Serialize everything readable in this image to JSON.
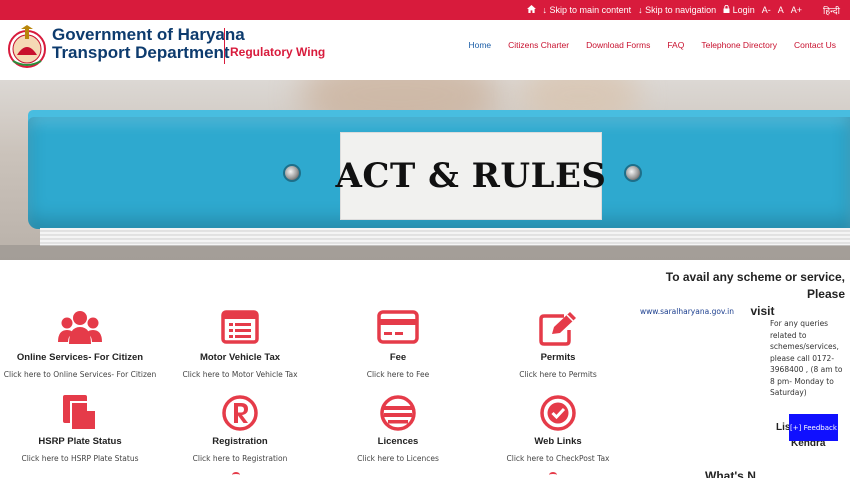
{
  "topbar": {
    "skip_main": "Skip to main content",
    "skip_nav": "Skip to navigation",
    "login": "Login",
    "font_small": "A-",
    "font_normal": "A",
    "font_large": "A+",
    "hindi": "हिन्दी"
  },
  "header": {
    "gov_title": "Government of Haryana",
    "dept_title": "Transport Department",
    "wing": "Regulatory Wing"
  },
  "nav": [
    "Home",
    "Citizens Charter",
    "Download Forms",
    "FAQ",
    "Telephone Directory",
    "Contact Us"
  ],
  "banner": {
    "label": "ACT & RULES"
  },
  "services": [
    {
      "title": "Online Services- For Citizen",
      "link": "Click here to Online Services- For Citizen",
      "icon": "users-icon"
    },
    {
      "title": "Motor Vehicle Tax",
      "link": "Click here to Motor Vehicle Tax",
      "icon": "list-window-icon"
    },
    {
      "title": "Fee",
      "link": "Click here to Fee",
      "icon": "credit-card-icon"
    },
    {
      "title": "Permits",
      "link": "Click here to Permits",
      "icon": "edit-icon"
    },
    {
      "title": "HSRP Plate Status",
      "link": "Click here to HSRP Plate Status",
      "icon": "file-copy-icon"
    },
    {
      "title": "Registration",
      "link": "Click here to Registration",
      "icon": "registered-icon"
    },
    {
      "title": "Licences",
      "link": "Click here to Licences",
      "icon": "licence-icon"
    },
    {
      "title": "Web Links",
      "link": "Click here to CheckPost Tax",
      "icon": "check-circle-icon"
    }
  ],
  "sidebar": {
    "avail_line1": "To avail any scheme or service, Please",
    "avail_line2": "visit",
    "saral_link": "www.saralharyana.gov.in",
    "queries": "For any queries related to schemes/services, please call 0172-3968400 , (8 am to 8 pm- Monday to Saturday)",
    "list_partial": "Lis",
    "kendra": "Kendra",
    "whats_new": "What's N"
  },
  "feedback": {
    "label": "[+] Feedback"
  },
  "colors": {
    "brand_red": "#d81b3c",
    "navy": "#0d3b6e",
    "icon_red": "#e53b49",
    "nav_active": "#1c5fa8",
    "folder_blue": "#2ea9cf"
  }
}
